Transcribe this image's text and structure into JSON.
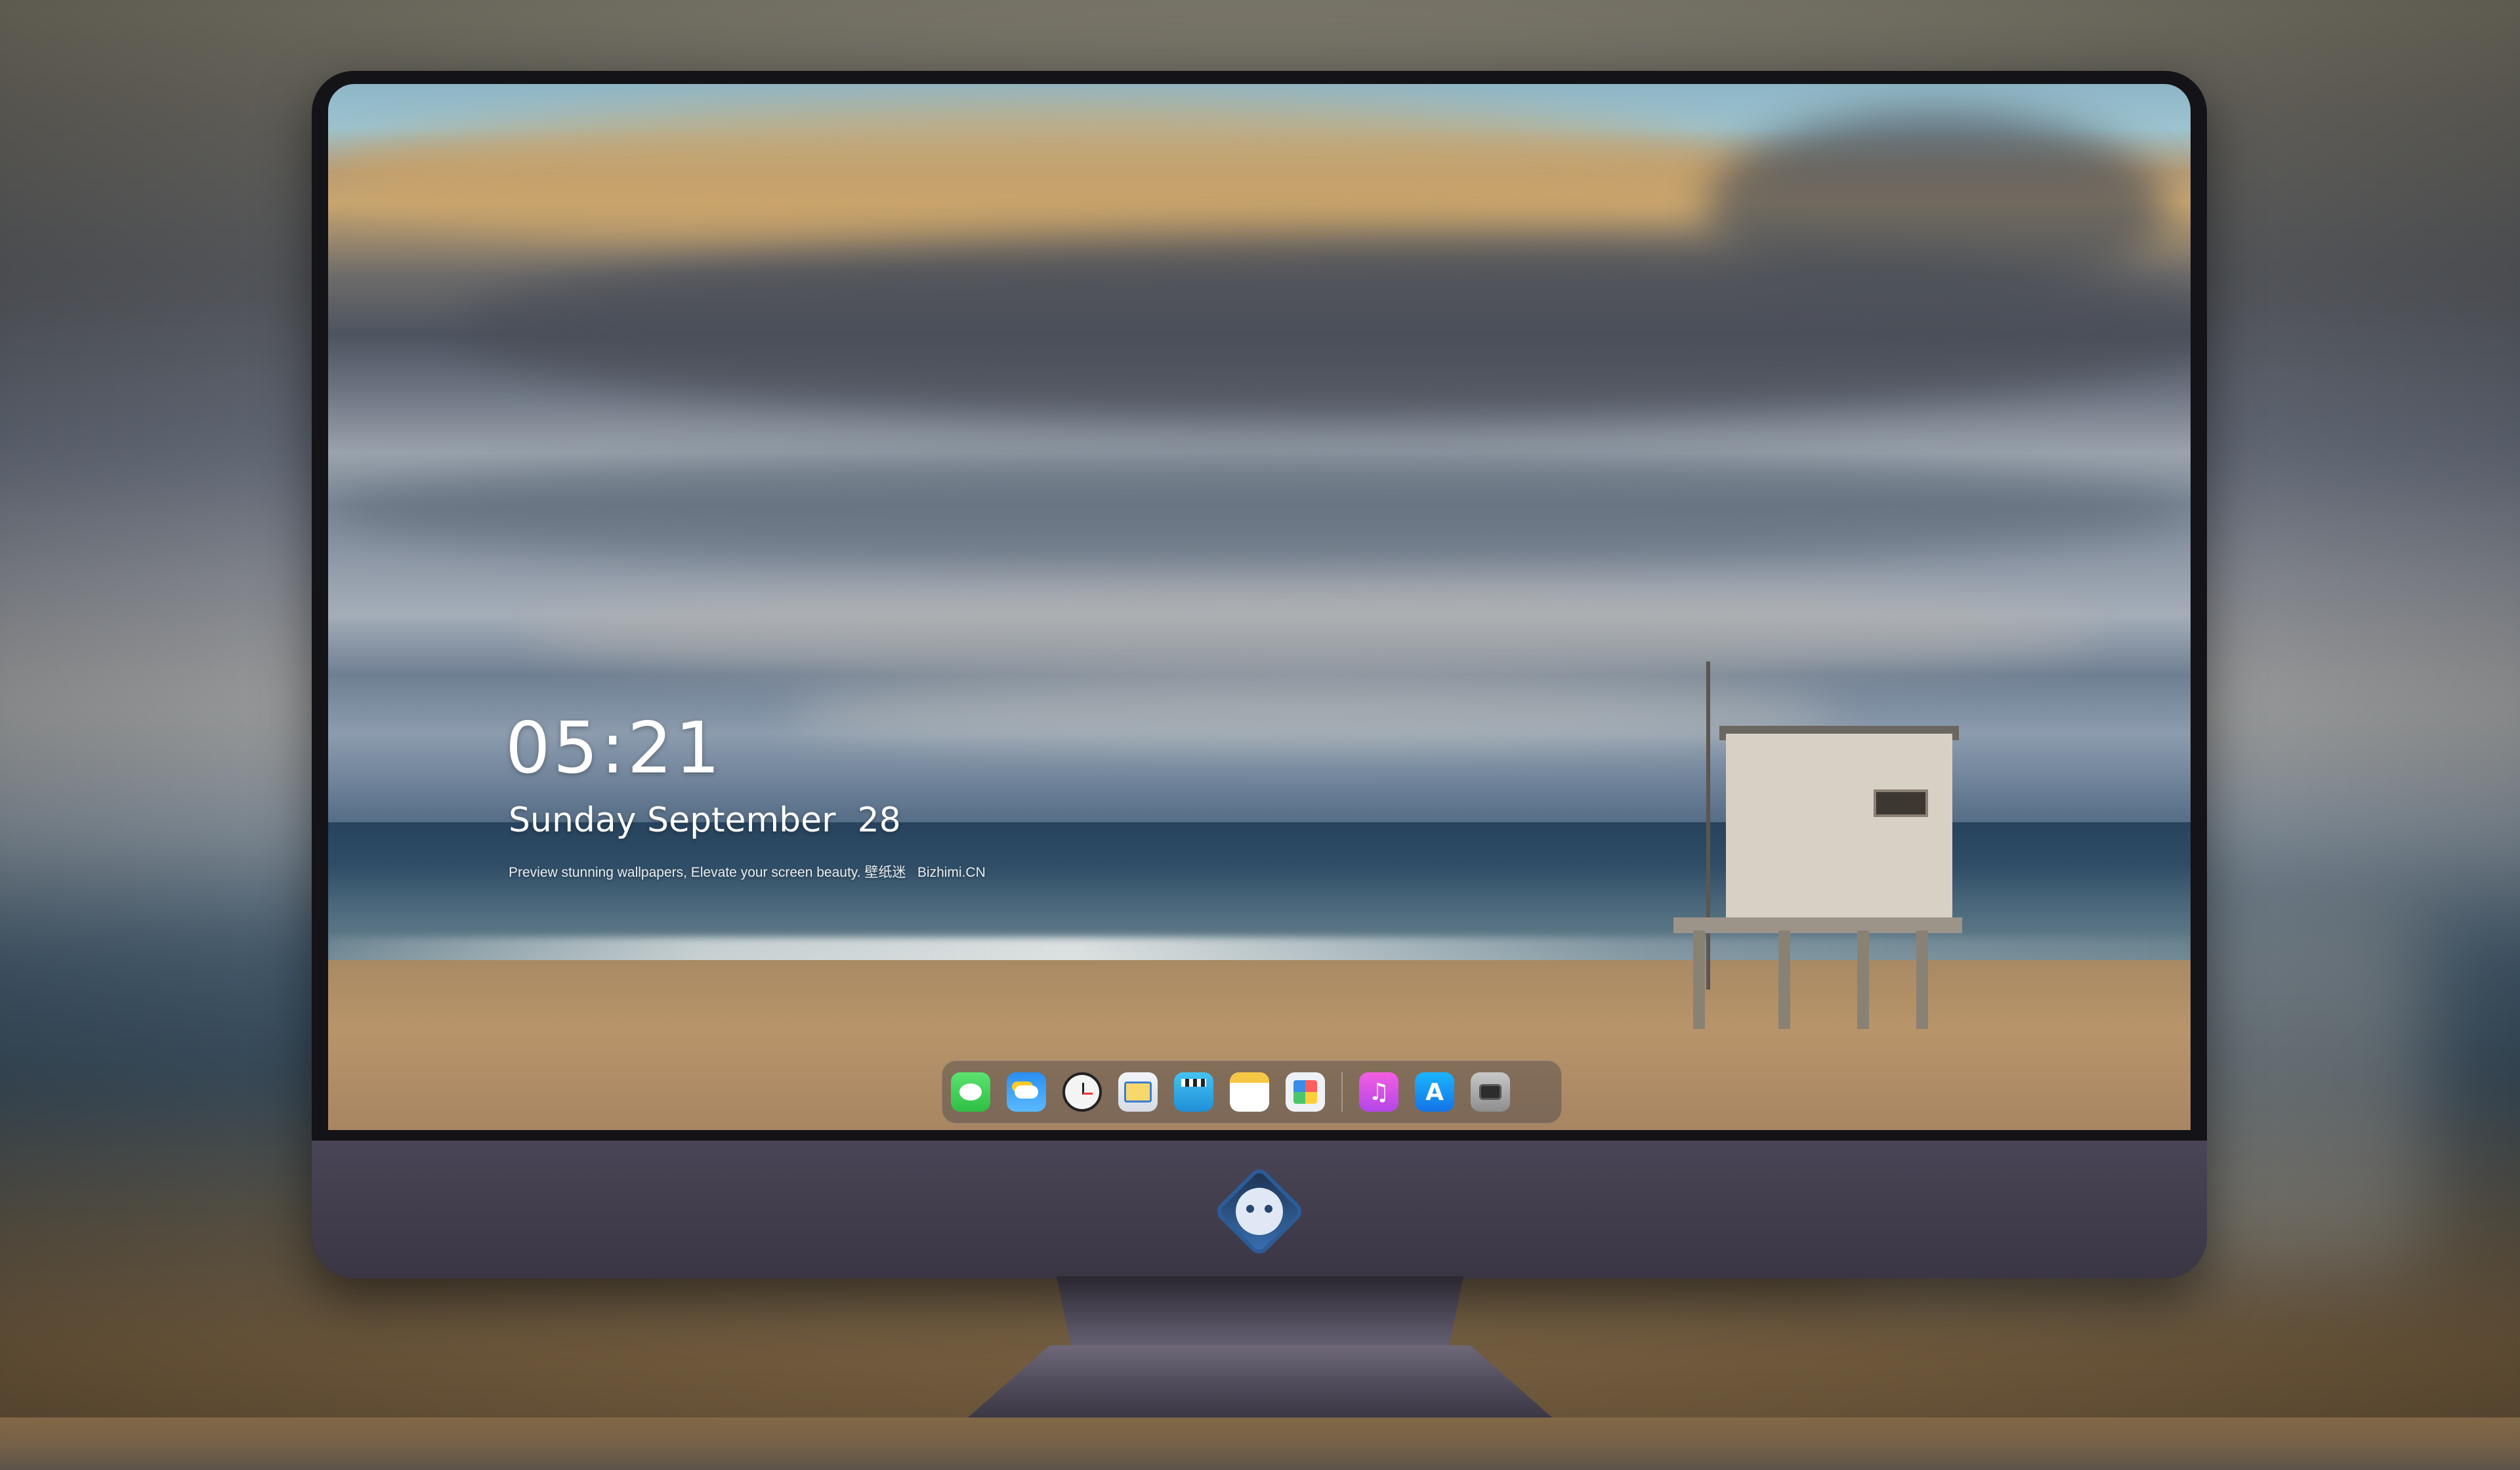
{
  "desktop": {
    "clock": {
      "time": "05:21",
      "date": "Sunday September  28",
      "tagline": "Preview stunning wallpapers, Elevate your screen beauty. 壁纸迷   Bizhimi.CN"
    },
    "dock": {
      "apps": [
        {
          "name": "Messages",
          "icon": "messages-icon"
        },
        {
          "name": "Weather",
          "icon": "weather-icon"
        },
        {
          "name": "Clock",
          "icon": "clock-icon"
        },
        {
          "name": "Preview",
          "icon": "preview-icon"
        },
        {
          "name": "Clips",
          "icon": "clips-icon"
        },
        {
          "name": "Notes",
          "icon": "notes-icon"
        },
        {
          "name": "Photos",
          "icon": "photos-icon"
        },
        {
          "name": "Music",
          "icon": "music-icon",
          "glyph": "♫"
        },
        {
          "name": "App Store",
          "icon": "app-store-icon",
          "glyph": "A"
        },
        {
          "name": "Camera",
          "icon": "camera-icon"
        }
      ]
    }
  },
  "monitor": {
    "chin_logo": "bizhimi-mascot-logo"
  },
  "colors": {
    "monitor_bezel": "#141317",
    "monitor_chin": "#3a3644",
    "text": "#ffffff"
  }
}
